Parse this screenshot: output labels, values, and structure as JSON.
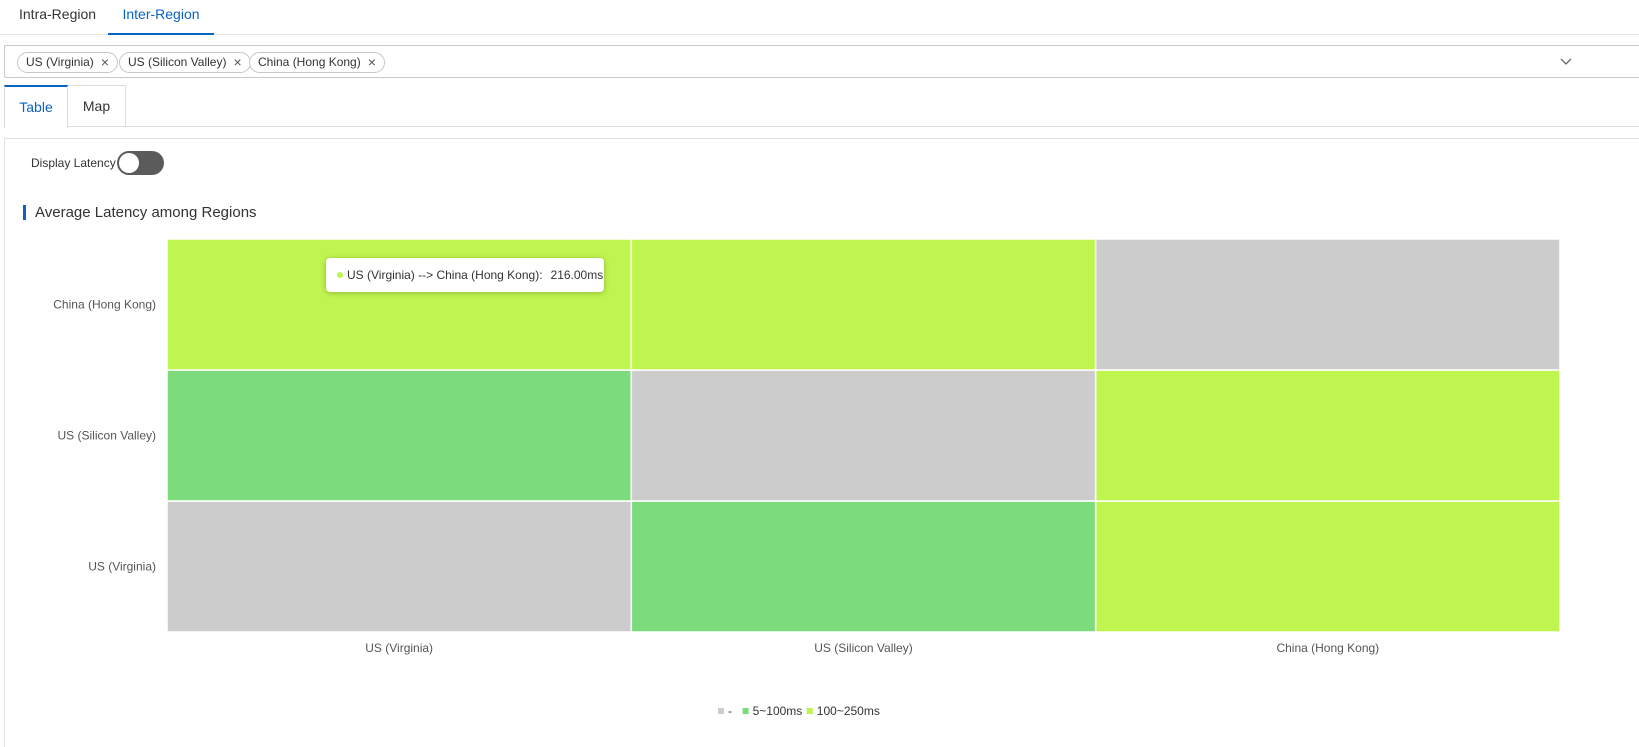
{
  "top_tabs": [
    {
      "label": "Intra-Region",
      "active": false
    },
    {
      "label": "Inter-Region",
      "active": true
    }
  ],
  "region_selector": {
    "selected": [
      "US (Virginia)",
      "US (Silicon Valley)",
      "China (Hong Kong)"
    ],
    "remove_glyph": "×",
    "chevron_icon": "chevron-down-icon"
  },
  "view_tabs": [
    {
      "label": "Table",
      "active": true
    },
    {
      "label": "Map",
      "active": false
    }
  ],
  "display_latency": {
    "label": "Display Latency",
    "on": false
  },
  "section_title": "Average Latency among Regions",
  "tooltip": {
    "route": "US (Virginia) --> China (Hong Kong):",
    "value": "216.00ms",
    "color": "#bff54f"
  },
  "colors": {
    "accent": "#0a62c4",
    "none": "#cccccc",
    "range_5_100": "#7cdc7c",
    "range_100_250": "#bff54f"
  },
  "chart_data": {
    "type": "heatmap",
    "title": "Average Latency among Regions",
    "x_categories": [
      "US (Virginia)",
      "US (Silicon Valley)",
      "China (Hong Kong)"
    ],
    "y_categories": [
      "US (Virginia)",
      "US (Silicon Valley)",
      "China (Hong Kong)"
    ],
    "cells": [
      {
        "x": "US (Virginia)",
        "y": "US (Virginia)",
        "bucket": "-"
      },
      {
        "x": "US (Silicon Valley)",
        "y": "US (Virginia)",
        "bucket": "5~100ms"
      },
      {
        "x": "China (Hong Kong)",
        "y": "US (Virginia)",
        "bucket": "100~250ms"
      },
      {
        "x": "US (Virginia)",
        "y": "US (Silicon Valley)",
        "bucket": "5~100ms"
      },
      {
        "x": "US (Silicon Valley)",
        "y": "US (Silicon Valley)",
        "bucket": "-"
      },
      {
        "x": "China (Hong Kong)",
        "y": "US (Silicon Valley)",
        "bucket": "100~250ms"
      },
      {
        "x": "US (Virginia)",
        "y": "China (Hong Kong)",
        "bucket": "100~250ms",
        "value_ms": 216.0
      },
      {
        "x": "US (Silicon Valley)",
        "y": "China (Hong Kong)",
        "bucket": "100~250ms"
      },
      {
        "x": "China (Hong Kong)",
        "y": "China (Hong Kong)",
        "bucket": "-"
      }
    ],
    "legend": [
      {
        "label": "-",
        "color": "#cccccc"
      },
      {
        "label": "5~100ms",
        "color": "#7cdc7c"
      },
      {
        "label": "100~250ms",
        "color": "#bff54f"
      }
    ],
    "legend_position": "bottom-center"
  }
}
